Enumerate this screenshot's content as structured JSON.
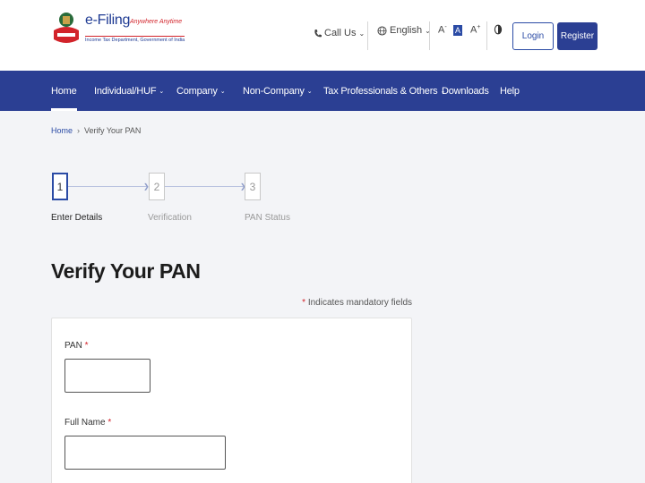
{
  "header": {
    "logo": {
      "title": "e-Filing",
      "tagline": "Anywhere Anytime",
      "subtitle": "Income Tax Department, Government of India",
      "emblem_text": "INCOME TAX DEPARTMENT"
    },
    "call_us": "Call Us",
    "language": "English",
    "font_sizes": [
      "A",
      "A",
      "A"
    ],
    "login_label": "Login",
    "register_label": "Register"
  },
  "nav": {
    "items": [
      {
        "label": "Home",
        "active": true
      },
      {
        "label": "Individual/HUF",
        "dropdown": true
      },
      {
        "label": "Company",
        "dropdown": true
      },
      {
        "label": "Non-Company",
        "dropdown": true
      },
      {
        "label": "Tax Professionals & Others",
        "dropdown": true
      },
      {
        "label": "Downloads"
      },
      {
        "label": "Help"
      }
    ]
  },
  "breadcrumb": {
    "home": "Home",
    "separator": "›",
    "current": "Verify Your PAN"
  },
  "stepper": {
    "steps": [
      {
        "number": "1",
        "label": "Enter Details",
        "active": true
      },
      {
        "number": "2",
        "label": "Verification"
      },
      {
        "number": "3",
        "label": "PAN Status"
      }
    ]
  },
  "main": {
    "title": "Verify Your PAN",
    "mandatory_star": "*",
    "mandatory_note": "Indicates mandatory fields",
    "fields": [
      {
        "label": "PAN",
        "required": "*",
        "value": ""
      },
      {
        "label": "Full Name",
        "required": "*",
        "value": ""
      }
    ]
  },
  "colors": {
    "brand_blue": "#2b3f93",
    "accent_red": "#d2232a"
  }
}
